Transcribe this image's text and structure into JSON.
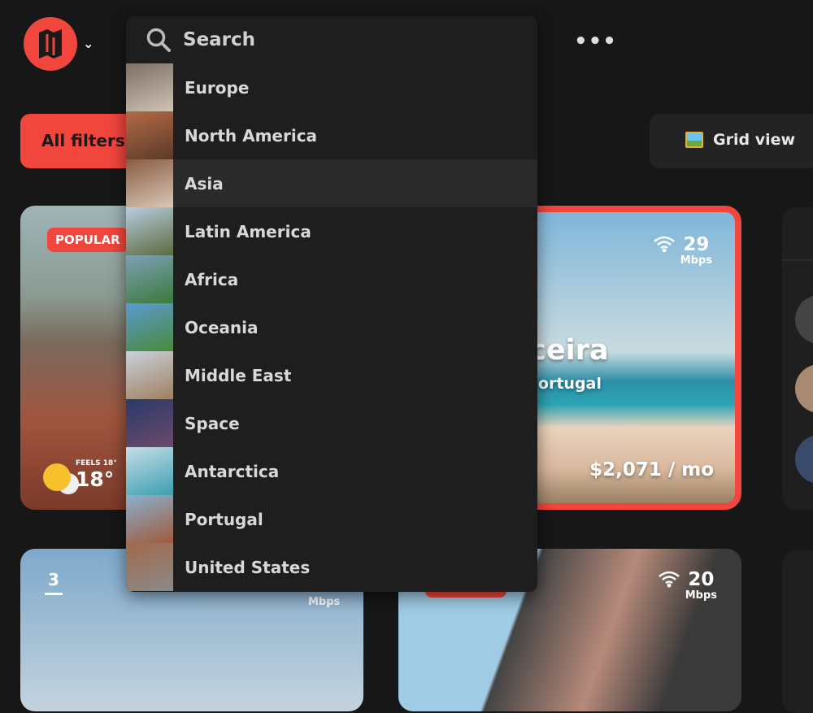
{
  "header": {
    "more_label": "•••"
  },
  "toolbar": {
    "filters_label": "All filters",
    "grid_label": "Grid view"
  },
  "search": {
    "placeholder": "Search"
  },
  "dropdown": {
    "items": [
      {
        "label": "Europe",
        "thumb": [
          "#7b6f66",
          "#cfc3b5"
        ]
      },
      {
        "label": "North America",
        "thumb": [
          "#b46a45",
          "#5a3a2a"
        ]
      },
      {
        "label": "Asia",
        "thumb": [
          "#8a5a40",
          "#d8c8b8"
        ],
        "hover": true
      },
      {
        "label": "Latin America",
        "thumb": [
          "#b7cde0",
          "#5d6a3d"
        ]
      },
      {
        "label": "Africa",
        "thumb": [
          "#7fa0b7",
          "#3a7a3a"
        ]
      },
      {
        "label": "Oceania",
        "thumb": [
          "#5a9ad0",
          "#4a8a3a"
        ]
      },
      {
        "label": "Middle East",
        "thumb": [
          "#c8d2dc",
          "#a08060"
        ]
      },
      {
        "label": "Space",
        "thumb": [
          "#2a3a6a",
          "#6a4a6a"
        ]
      },
      {
        "label": "Antarctica",
        "thumb": [
          "#c8dce8",
          "#3aa0b0"
        ]
      },
      {
        "label": "Portugal",
        "thumb": [
          "#8ab0d0",
          "#a05a3a"
        ]
      },
      {
        "label": "United States",
        "thumb": [
          "#a06a4a",
          "#8a8a8a"
        ]
      }
    ]
  },
  "cards": [
    {
      "badge": "POPULAR",
      "feels": "FEELS 18°",
      "temp": "18°"
    },
    {
      "wifi": "29",
      "wifi_unit": "Mbps",
      "city": "Ericeira",
      "country": "Portugal",
      "price": "$2,071 / mo"
    },
    {
      "rank": "3",
      "wifi_unit": "Mbps"
    },
    {
      "wifi": "20",
      "wifi_unit": "Mbps"
    }
  ],
  "colors": {
    "accent": "#f0463e",
    "background": "#171717",
    "dropdown": "#1e1e1e"
  }
}
